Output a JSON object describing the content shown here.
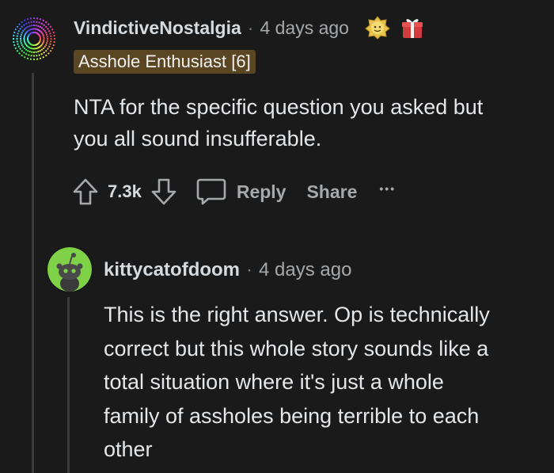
{
  "comment": {
    "username": "VindictiveNostalgia",
    "separator": "·",
    "timestamp": "4 days ago",
    "flair": "Asshole Enthusiast [6]",
    "body": "NTA for the specific question you asked but\nyou all sound insufferable.",
    "upvote_count": "7.3k",
    "reply_label": "Reply",
    "share_label": "Share",
    "more_label": "•••",
    "awards": [
      "helpful-award-icon",
      "gift-award-icon"
    ]
  },
  "reply": {
    "username": "kittycatofdoom",
    "separator": "·",
    "timestamp": "4 days ago",
    "body": "This is the right answer. Op is technically\ncorrect but this whole story sounds like a\ntotal situation where it's just a whole\nfamily of assholes being terrible to each\nother"
  },
  "colors": {
    "background": "#1a1a1b",
    "flair_bg": "#5a4622",
    "thread_line": "#3a3a3c",
    "reply_avatar_bg": "#7fd148"
  }
}
